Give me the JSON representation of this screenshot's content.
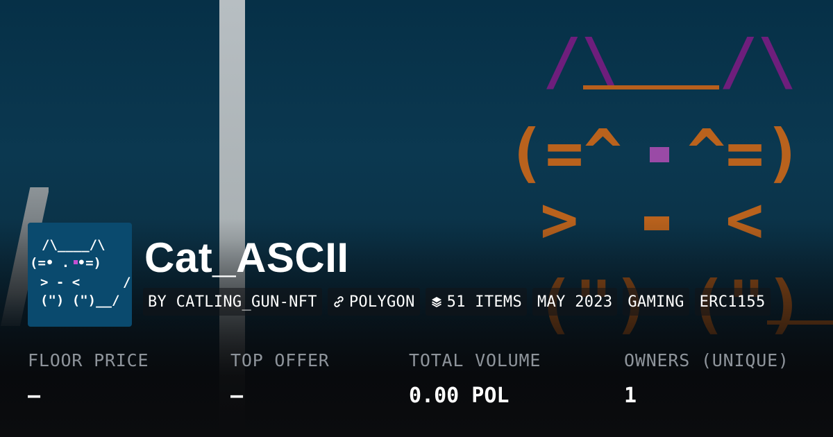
{
  "collection": {
    "name": "Cat_ASCII",
    "avatar_art": [
      "/\\____/\\",
      "(=• . •=)",
      "> - <",
      "(\") (\")__/"
    ]
  },
  "chips": [
    {
      "label": "BY CATLING_GUN-NFT",
      "icon": ""
    },
    {
      "label": "POLYGON",
      "icon": "link-icon"
    },
    {
      "label": "51 ITEMS",
      "icon": "layers-icon"
    },
    {
      "label": "MAY 2023",
      "icon": ""
    },
    {
      "label": "GAMING",
      "icon": ""
    },
    {
      "label": "ERC1155",
      "icon": ""
    }
  ],
  "stats": [
    {
      "label": "FLOOR PRICE",
      "value": "–"
    },
    {
      "label": "TOP OFFER",
      "value": "–"
    },
    {
      "label": "TOTAL VOLUME",
      "value": "0.00 POL"
    },
    {
      "label": "OWNERS (UNIQUE)",
      "value": "1"
    }
  ],
  "colors": {
    "background": "#0b3850",
    "avatar_bg": "#0a4a6e",
    "ascii_orange": "#c9681e",
    "ascii_purple": "#7b1d8a",
    "nose_pink": "#c24fd1",
    "label_gray": "#8e949b",
    "text": "#ffffff"
  }
}
